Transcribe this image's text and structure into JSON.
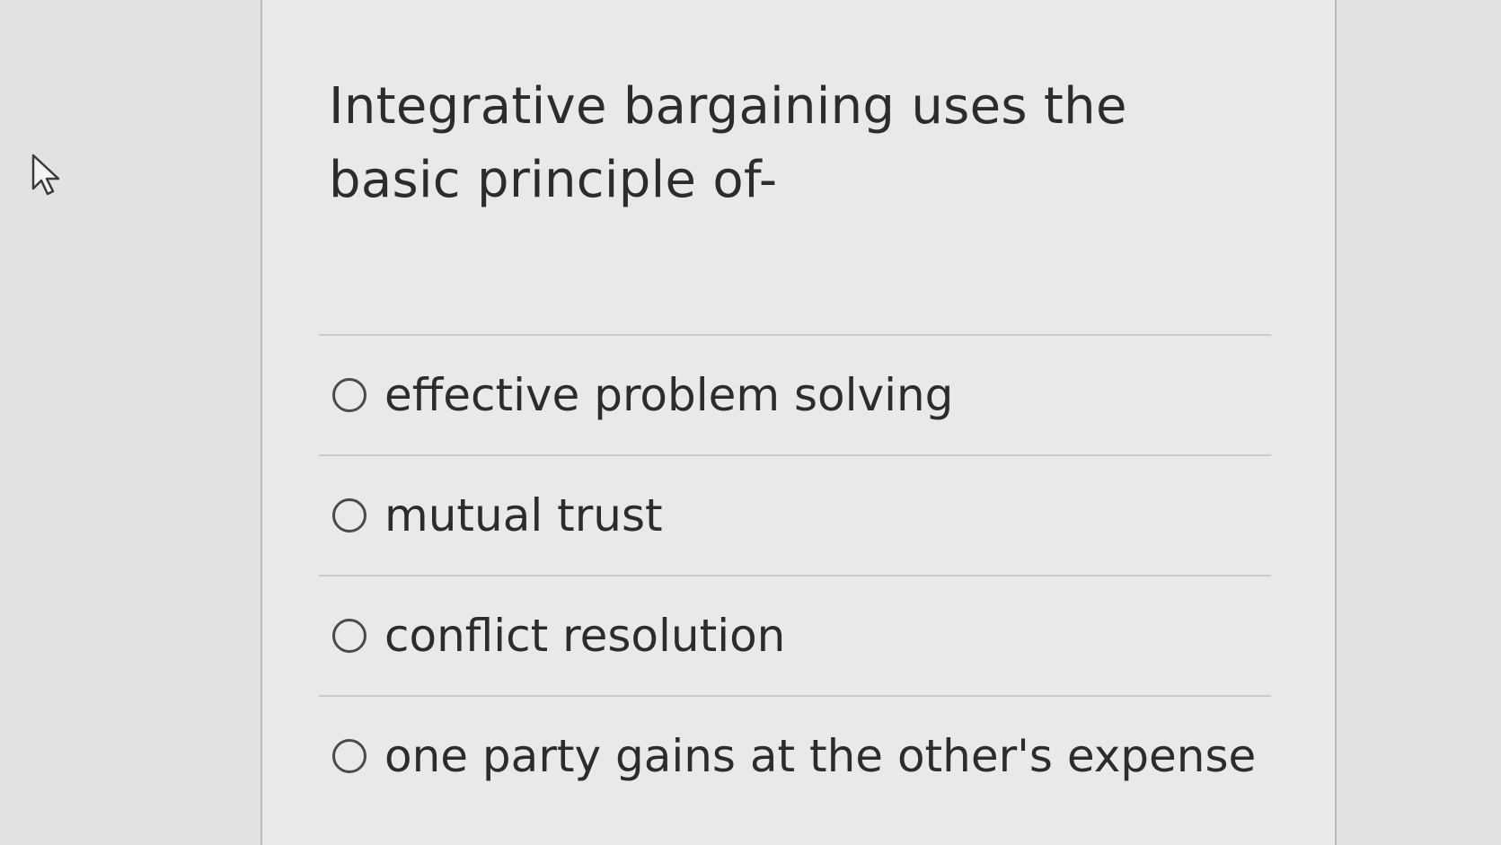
{
  "question": {
    "text": "Integrative bargaining uses the basic principle of-"
  },
  "options": [
    {
      "label": "effective problem solving",
      "selected": false
    },
    {
      "label": "mutual trust",
      "selected": false
    },
    {
      "label": "conflict resolution",
      "selected": false
    },
    {
      "label": "one party gains at the other's expense",
      "selected": false
    }
  ],
  "icons": {
    "cursor": "mouse-pointer-icon",
    "radio": "radio-unselected-icon"
  }
}
